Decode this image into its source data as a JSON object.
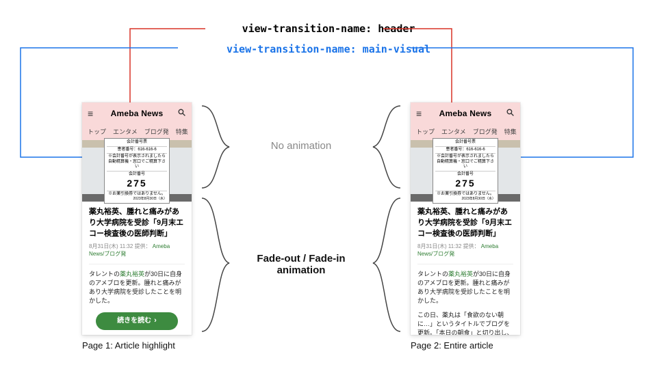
{
  "labels": {
    "vt_header": "view-transition-name: header",
    "vt_main": "view-transition-name: main-visual",
    "no_anim": "No animation",
    "fade_anim": "Fade-out / Fade-in animation",
    "caption1": "Page 1: Article highlight",
    "caption2": "Page 2: Entire article"
  },
  "page": {
    "brand": "Ameba News",
    "tabs": [
      "トップ",
      "エンタメ",
      "ブログ発",
      "特集"
    ],
    "ticket": {
      "title": "会計番号票",
      "row1": "患者番号：616-616-6",
      "row2": "※会計番号が表示されましたら\n自動精算機・窓口でご精算下さい",
      "label": "会計番号",
      "number": "275",
      "foot": "※お薬引換券ではありません。",
      "date": "2023年8月30日（水）"
    },
    "headline": "薬丸裕英、腫れと痛みがあり大学病院を受診「9月末エコー検査後の医師判断」",
    "meta": {
      "time": "8月31日(木) 11:32",
      "provider": "提供：",
      "source": "Ameba News/ブログ発"
    },
    "body_common": {
      "pre": "タレントの",
      "link": "薬丸裕英",
      "post": "が30日に自身のアメブロを更新。腫れと痛みがあり大学病院を受診したことを明かした。"
    },
    "p1": {
      "cta": "続きを読む"
    },
    "p2": {
      "para2": "この日、薬丸は「食欲のない朝に…」というタイトルでブログを更新。「本日の朝食」と切り出し、「自"
    }
  }
}
